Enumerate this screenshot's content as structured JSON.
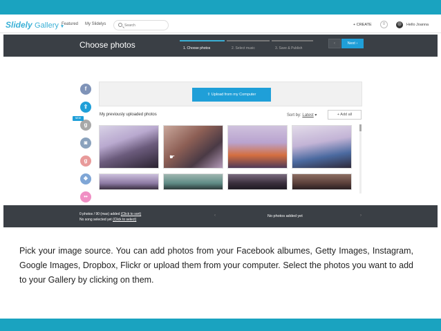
{
  "app": {
    "logo_brand": "Slidely",
    "logo_product": "Gallery",
    "nav": {
      "featured": "Featured",
      "my_slidelys": "My Slidelys"
    },
    "search": {
      "placeholder": "Search"
    },
    "create_label": "+ CREATE",
    "notifications_count": "0",
    "greeting": "Hello Joanna"
  },
  "wizard": {
    "title": "Choose photos",
    "steps": [
      {
        "label": "1. Choose photos",
        "active": true
      },
      {
        "label": "2. Select music",
        "active": false
      },
      {
        "label": "3. Save & Publish",
        "active": false
      }
    ],
    "prev_label": "‹",
    "next_label": "Next ›"
  },
  "sources": {
    "items": [
      {
        "name": "facebook",
        "glyph": "f",
        "color": "#7f93b8"
      },
      {
        "name": "upload",
        "glyph": "⇧",
        "color": "#1f9fd8"
      },
      {
        "name": "getty-images",
        "glyph": "g",
        "color": "#a8a8a8"
      },
      {
        "name": "instagram",
        "glyph": "◙",
        "color": "#8aa2bd"
      },
      {
        "name": "google-images",
        "glyph": "g",
        "color": "#e89a9a"
      },
      {
        "name": "dropbox",
        "glyph": "❖",
        "color": "#7fa6d6"
      },
      {
        "name": "flickr",
        "glyph": "••",
        "color": "#f08fc4"
      }
    ],
    "new_badge": "NEW"
  },
  "upload": {
    "button_label": "⇧ Upload from my Computer",
    "section_title": "My previously uploaded photos",
    "sort_label": "Sort by:",
    "sort_value": "Latest",
    "add_all_label": "+ Add all"
  },
  "photos": [
    {
      "name": "photo-1"
    },
    {
      "name": "photo-2"
    },
    {
      "name": "photo-3"
    },
    {
      "name": "photo-4"
    },
    {
      "name": "photo-5"
    },
    {
      "name": "photo-6"
    },
    {
      "name": "photo-7"
    },
    {
      "name": "photo-8"
    }
  ],
  "status": {
    "photos_added": "0 photos / 90 (max) added",
    "sort_link": "(Click to sort)",
    "song_status": "No song selected yet",
    "select_link": "(Click to select)",
    "no_photos": "No photos added yet",
    "left_arrow": "‹",
    "right_arrow": "›"
  },
  "caption": "Pick your image source. You can add photos from your Facebook albumes, Getty Images, Instagram, Google Images, Dropbox, Flickr or upload them from your computer. Select the photos you want to add to your Gallery by clicking on them."
}
